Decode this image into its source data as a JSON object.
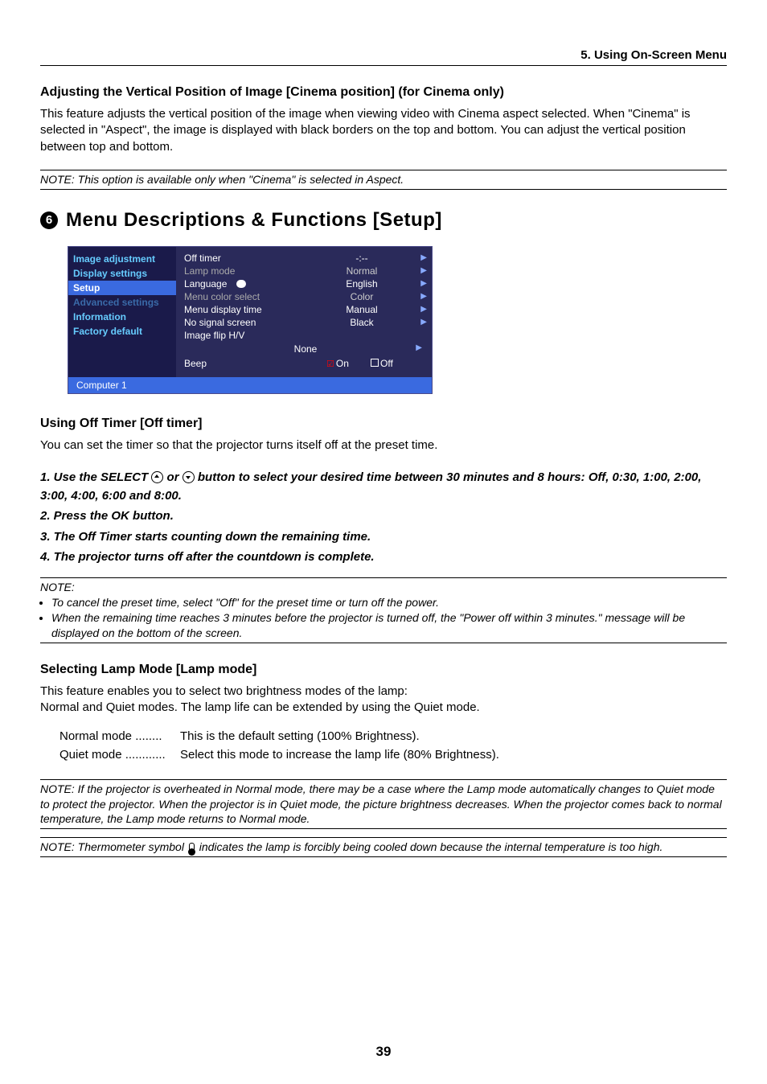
{
  "header": {
    "section": "5. Using On-Screen Menu"
  },
  "cinema": {
    "heading": "Adjusting the Vertical Position of Image [Cinema position] (for Cinema only)",
    "body": "This feature adjusts the vertical position of the image when viewing video with Cinema aspect selected. When \"Cinema\" is selected in \"Aspect\", the image is displayed with black borders on the top and bottom. You can adjust the vertical position between top and bottom.",
    "note": "NOTE: This option is available only when \"Cinema\" is selected in Aspect."
  },
  "setup": {
    "num": "6",
    "title": "Menu Descriptions & Functions [Setup]"
  },
  "osd": {
    "left": [
      {
        "label": "Image adjustment",
        "state": "normal"
      },
      {
        "label": "Display settings",
        "state": "normal"
      },
      {
        "label": "Setup",
        "state": "sel"
      },
      {
        "label": "Advanced settings",
        "state": "dim"
      },
      {
        "label": "Information",
        "state": "normal"
      },
      {
        "label": "Factory default",
        "state": "normal"
      }
    ],
    "rows": [
      {
        "label": "Off timer",
        "value": "-:--",
        "active": true
      },
      {
        "label": "Lamp mode",
        "value": "Normal",
        "active": false
      },
      {
        "label": "Language",
        "value": "English",
        "active": true,
        "icon": true
      },
      {
        "label": "Menu color select",
        "value": "Color",
        "active": false
      },
      {
        "label": "Menu display time",
        "value": "Manual",
        "active": true
      },
      {
        "label": "No signal screen",
        "value": "Black",
        "active": true
      },
      {
        "label": "Image flip H/V",
        "value": "",
        "active": true
      }
    ],
    "none": "None",
    "beep": {
      "label": "Beep",
      "on": "On",
      "off": "Off"
    },
    "footer": "Computer 1"
  },
  "offtimer": {
    "heading": "Using Off Timer [Off timer]",
    "body": "You can set the timer so that the projector turns itself off at the preset time.",
    "steps": [
      "1.  Use the SELECT ",
      " or ",
      " button to select your desired time between 30 minutes and 8 hours: Off, 0:30, 1:00, 2:00, 3:00, 4:00, 6:00 and 8:00.",
      "2.  Press the OK button.",
      "3.  The Off Timer starts counting down the remaining time.",
      "4.  The projector turns off after the countdown is complete."
    ],
    "note_label": "NOTE:",
    "note_items": [
      "To cancel the preset time, select \"Off\" for the preset time or turn off the power.",
      "When the remaining time reaches 3 minutes before the projector is turned off, the \"Power off within 3 minutes.\" message will be displayed on the bottom of the screen."
    ]
  },
  "lampmode": {
    "heading": "Selecting Lamp Mode [Lamp mode]",
    "body1": "This feature enables you to select two brightness modes of the lamp:",
    "body2": "Normal and Quiet modes. The lamp life can be extended by using the Quiet mode.",
    "modes": [
      {
        "name": "Normal mode ........",
        "desc": "This is the default setting (100% Brightness)."
      },
      {
        "name": "Quiet mode ............",
        "desc": "Select this mode to increase the lamp life (80% Brightness)."
      }
    ],
    "note1": "NOTE: If the projector is overheated in Normal mode, there may be a case where the Lamp mode automatically changes to Quiet mode to protect the projector. When the projector is in Quiet mode, the picture brightness decreases. When the projector comes back to normal temperature, the Lamp mode returns to Normal mode.",
    "note2a": "NOTE: Thermometer symbol ",
    "note2b": " indicates the lamp is forcibly being cooled down because the internal temperature is too high."
  },
  "page_number": "39"
}
